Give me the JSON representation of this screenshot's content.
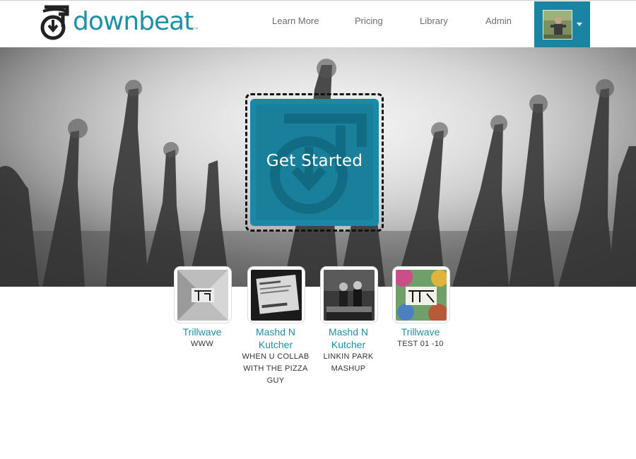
{
  "header": {
    "logo_text": "downbeat",
    "logo_tm": "™",
    "nav": [
      {
        "label": "Learn More"
      },
      {
        "label": "Pricing"
      },
      {
        "label": "Library"
      },
      {
        "label": "Admin"
      }
    ],
    "user_menu_icon": "caret-down-icon"
  },
  "hero": {
    "cta_label": "Get Started"
  },
  "tracks": [
    {
      "artist": "Trillwave",
      "title": "www"
    },
    {
      "artist": "Mashd N Kutcher",
      "title": "WHEN U COLLAB WITH THE PIZZA GUY"
    },
    {
      "artist": "Mashd N Kutcher",
      "title": "LINKIN PARK MASHUP"
    },
    {
      "artist": "Trillwave",
      "title": "Test 01 -10"
    }
  ],
  "colors": {
    "brand": "#1d8fa8",
    "user_box": "#1a85a3",
    "cta": "#188aa8"
  }
}
